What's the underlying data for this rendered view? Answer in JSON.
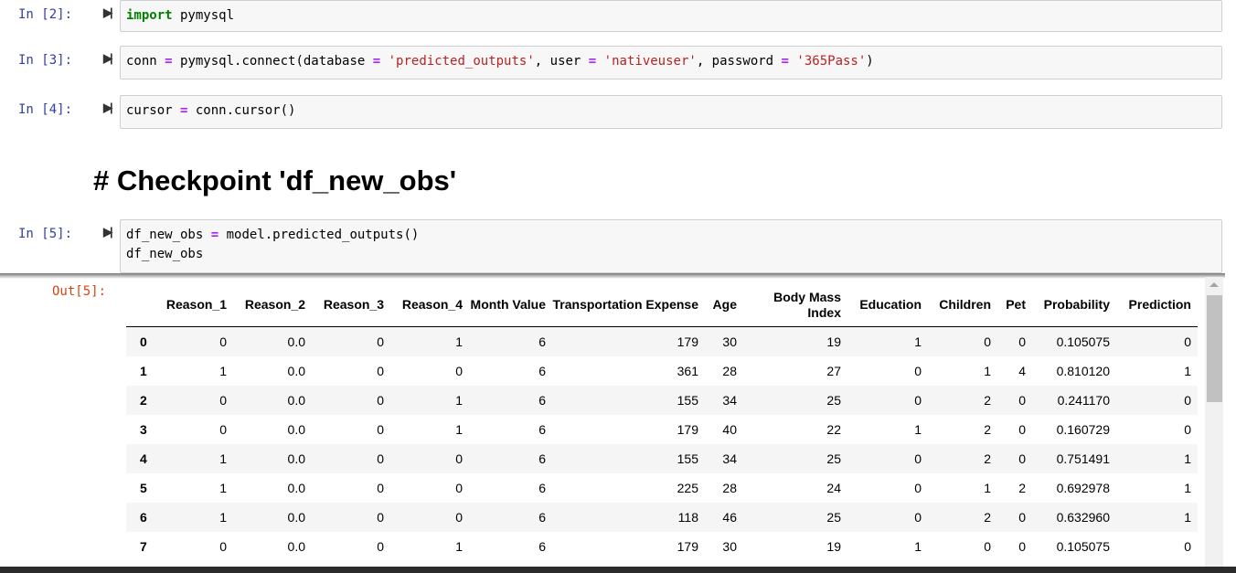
{
  "cells": [
    {
      "prompt": "In [2]:",
      "code": [
        {
          "t": "import",
          "c": "kw"
        },
        {
          "t": " pymysql",
          "c": ""
        }
      ]
    },
    {
      "prompt": "In [3]:",
      "code": [
        {
          "t": "conn ",
          "c": ""
        },
        {
          "t": "=",
          "c": "op"
        },
        {
          "t": " pymysql.connect(database ",
          "c": ""
        },
        {
          "t": "=",
          "c": "op"
        },
        {
          "t": " ",
          "c": ""
        },
        {
          "t": "'predicted_outputs'",
          "c": "str"
        },
        {
          "t": ", user ",
          "c": ""
        },
        {
          "t": "=",
          "c": "op"
        },
        {
          "t": " ",
          "c": ""
        },
        {
          "t": "'nativeuser'",
          "c": "str"
        },
        {
          "t": ", password ",
          "c": ""
        },
        {
          "t": "=",
          "c": "op"
        },
        {
          "t": " ",
          "c": ""
        },
        {
          "t": "'365Pass'",
          "c": "str"
        },
        {
          "t": ")",
          "c": ""
        }
      ]
    },
    {
      "prompt": "In [4]:",
      "code": [
        {
          "t": "cursor ",
          "c": ""
        },
        {
          "t": "=",
          "c": "op"
        },
        {
          "t": " conn.cursor()",
          "c": ""
        }
      ]
    },
    {
      "prompt": "In [5]:",
      "code": [
        {
          "t": "df_new_obs ",
          "c": ""
        },
        {
          "t": "=",
          "c": "op"
        },
        {
          "t": " model.predicted_outputs()\ndf_new_obs",
          "c": ""
        }
      ]
    }
  ],
  "heading": "# Checkpoint 'df_new_obs'",
  "output_prompt": "Out[5]:",
  "table": {
    "columns": [
      "",
      "Reason_1",
      "Reason_2",
      "Reason_3",
      "Reason_4",
      "Month Value",
      "Transportation Expense",
      "Age",
      "Body Mass Index",
      "Education",
      "Children",
      "Pet",
      "Probability",
      "Prediction"
    ],
    "rows": [
      [
        "0",
        "0",
        "0.0",
        "0",
        "1",
        "6",
        "179",
        "30",
        "19",
        "1",
        "0",
        "0",
        "0.105075",
        "0"
      ],
      [
        "1",
        "1",
        "0.0",
        "0",
        "0",
        "6",
        "361",
        "28",
        "27",
        "0",
        "1",
        "4",
        "0.810120",
        "1"
      ],
      [
        "2",
        "0",
        "0.0",
        "0",
        "1",
        "6",
        "155",
        "34",
        "25",
        "0",
        "2",
        "0",
        "0.241170",
        "0"
      ],
      [
        "3",
        "0",
        "0.0",
        "0",
        "1",
        "6",
        "179",
        "40",
        "22",
        "1",
        "2",
        "0",
        "0.160729",
        "0"
      ],
      [
        "4",
        "1",
        "0.0",
        "0",
        "0",
        "6",
        "155",
        "34",
        "25",
        "0",
        "2",
        "0",
        "0.751491",
        "1"
      ],
      [
        "5",
        "1",
        "0.0",
        "0",
        "0",
        "6",
        "225",
        "28",
        "24",
        "0",
        "1",
        "2",
        "0.692978",
        "1"
      ],
      [
        "6",
        "1",
        "0.0",
        "0",
        "0",
        "6",
        "118",
        "46",
        "25",
        "0",
        "2",
        "0",
        "0.632960",
        "1"
      ],
      [
        "7",
        "0",
        "0.0",
        "0",
        "1",
        "6",
        "179",
        "30",
        "19",
        "1",
        "0",
        "0",
        "0.105075",
        "0"
      ]
    ]
  }
}
